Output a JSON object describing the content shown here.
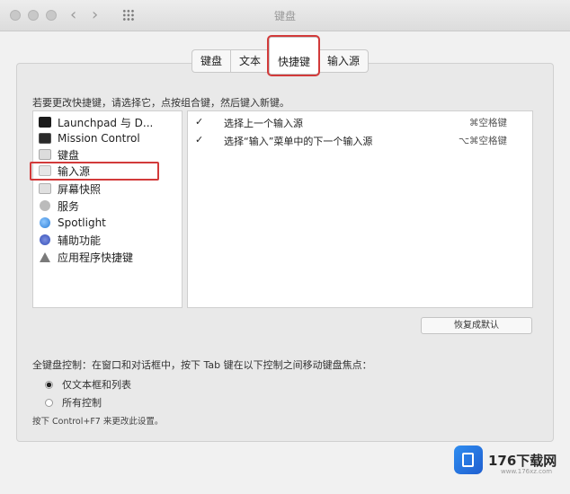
{
  "window": {
    "title": "键盘"
  },
  "tabs": [
    {
      "label": "键盘"
    },
    {
      "label": "文本"
    },
    {
      "label": "快捷键",
      "selected": true
    },
    {
      "label": "输入源"
    }
  ],
  "instruction": "若要更改快捷键，请选择它，点按组合键，然后键入新键。",
  "categories": [
    {
      "label": "Launchpad 与 D...",
      "icon": "launchpad-icon"
    },
    {
      "label": "Mission Control",
      "icon": "mission-control-icon"
    },
    {
      "label": "键盘",
      "icon": "keyboard-icon"
    },
    {
      "label": "输入源",
      "icon": "input-source-icon",
      "selected": true
    },
    {
      "label": "屏幕快照",
      "icon": "screenshot-icon"
    },
    {
      "label": "服务",
      "icon": "services-icon"
    },
    {
      "label": "Spotlight",
      "icon": "spotlight-icon"
    },
    {
      "label": "辅助功能",
      "icon": "accessibility-icon"
    },
    {
      "label": "应用程序快捷键",
      "icon": "app-shortcuts-icon"
    }
  ],
  "shortcuts": [
    {
      "checked": "✓",
      "name": "选择上一个输入源",
      "key": "⌘空格键"
    },
    {
      "checked": "✓",
      "name": "选择“输入”菜单中的下一个输入源",
      "key": "⌥⌘空格键"
    }
  ],
  "restore_button": "恢复成默认",
  "full_keyboard": {
    "label": "全键盘控制：在窗口和对话框中，按下 Tab 键在以下控制之间移动键盘焦点：",
    "options": [
      {
        "label": "仅文本框和列表",
        "selected": true
      },
      {
        "label": "所有控制",
        "selected": false
      }
    ],
    "hint": "按下 Control+F7 来更改此设置。"
  },
  "watermark": {
    "text": "176下载网",
    "sub": "www.176xz.com"
  },
  "colors": {
    "highlight": "#d23a3a",
    "panel": "#e9e9e9"
  }
}
